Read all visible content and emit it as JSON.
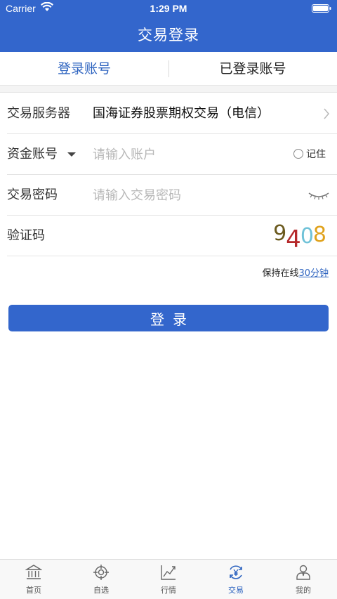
{
  "status_bar": {
    "carrier": "Carrier",
    "time": "1:29 PM"
  },
  "nav": {
    "title": "交易登录"
  },
  "tabs": [
    {
      "label": "登录账号",
      "active": true
    },
    {
      "label": "已登录账号",
      "active": false
    }
  ],
  "form": {
    "server": {
      "label": "交易服务器",
      "value": "国海证券股票期权交易（电信）"
    },
    "account": {
      "label": "资金账号",
      "placeholder": "请输入账户",
      "remember_label": "记住"
    },
    "password": {
      "label": "交易密码",
      "placeholder": "请输入交易密码"
    },
    "captcha": {
      "label": "验证码",
      "digits": [
        "9",
        "4",
        "0",
        "8"
      ],
      "digit_colors": [
        "#6b5a1e",
        "#b5282a",
        "#6fc2d8",
        "#e0a21c"
      ]
    }
  },
  "keep_online": {
    "prefix": "保持在线",
    "link": "30分钟"
  },
  "login_button": {
    "label": "登录"
  },
  "tabbar": [
    {
      "label": "首页",
      "icon": "bank-icon",
      "active": false
    },
    {
      "label": "自选",
      "icon": "target-icon",
      "active": false
    },
    {
      "label": "行情",
      "icon": "chart-icon",
      "active": false
    },
    {
      "label": "交易",
      "icon": "trade-icon",
      "active": true
    },
    {
      "label": "我的",
      "icon": "person-icon",
      "active": false
    }
  ],
  "colors": {
    "primary": "#3366cc",
    "tab_active": "#2e64c0"
  }
}
